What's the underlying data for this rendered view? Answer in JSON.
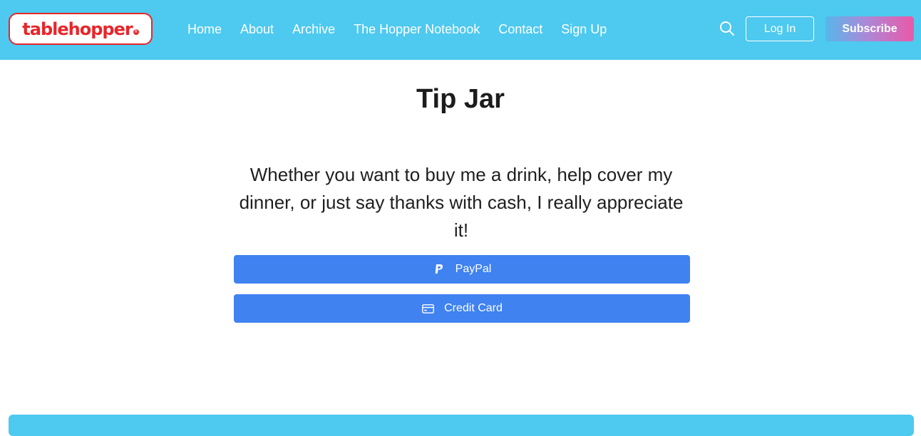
{
  "header": {
    "logo_text": "tablehopper",
    "logo_mark": "R",
    "nav": [
      {
        "label": "Home"
      },
      {
        "label": "About"
      },
      {
        "label": "Archive"
      },
      {
        "label": "The Hopper Notebook"
      },
      {
        "label": "Contact"
      },
      {
        "label": "Sign Up"
      }
    ],
    "search_icon": "search-icon",
    "login_label": "Log In",
    "subscribe_label": "Subscribe"
  },
  "main": {
    "title": "Tip Jar",
    "intro": "Whether you want to buy me a drink, help cover my dinner, or just say thanks with cash, I really appreciate it!",
    "buttons": [
      {
        "label": "PayPal",
        "icon": "paypal-icon"
      },
      {
        "label": "Credit Card",
        "icon": "credit-card-icon"
      }
    ]
  },
  "colors": {
    "header_bg": "#4ec9ef",
    "logo_red": "#e8262b",
    "button_blue": "#3f82f0",
    "subscribe_gradient_start": "#57b6ea",
    "subscribe_gradient_end": "#ea59a8"
  }
}
